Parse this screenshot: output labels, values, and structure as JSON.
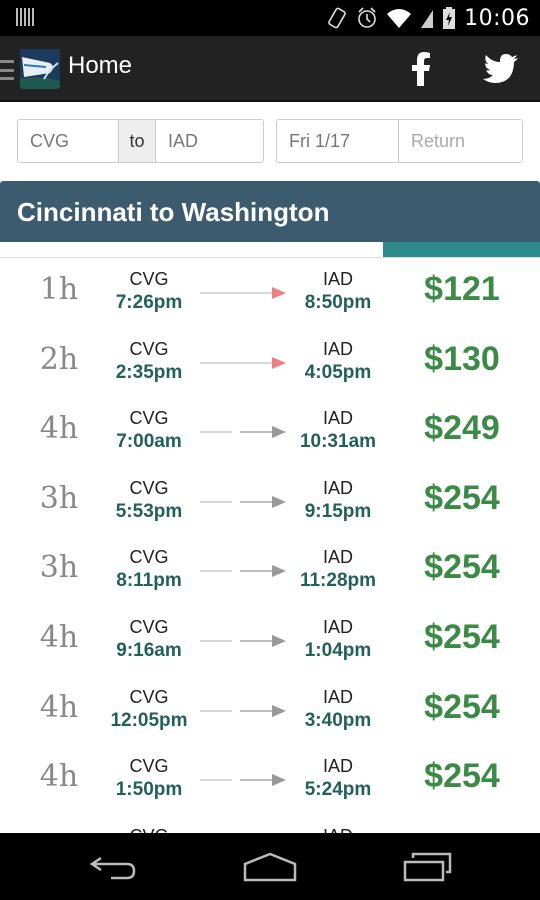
{
  "status_bar": {
    "time": "10:06",
    "icons": [
      "notification-icon",
      "vibrate-icon",
      "alarm-icon",
      "wifi-icon",
      "signal-icon",
      "battery-charging-icon"
    ]
  },
  "action_bar": {
    "title": "Home",
    "icons": [
      "menu-icon",
      "app-logo",
      "facebook-icon",
      "twitter-icon"
    ]
  },
  "search": {
    "origin": "CVG",
    "to_label": "to",
    "destination": "IAD",
    "depart_date": "Fri 1/17",
    "return_placeholder": "Return"
  },
  "route": {
    "title": "Cincinnati to Washington",
    "progress_percent": 71
  },
  "colors": {
    "header_bg": "#3d5b6e",
    "progress_fill": "#2e8b8b",
    "time_text": "#22605a",
    "price_text": "#3b8a45",
    "nonstop_arrow": "#f08080",
    "stop_arrow": "#999999"
  },
  "flights": [
    {
      "duration": "1h",
      "from": "CVG",
      "depart": "7:26pm",
      "to": "IAD",
      "arrive": "8:50pm",
      "price": "$121",
      "nonstop": true
    },
    {
      "duration": "2h",
      "from": "CVG",
      "depart": "2:35pm",
      "to": "IAD",
      "arrive": "4:05pm",
      "price": "$130",
      "nonstop": true
    },
    {
      "duration": "4h",
      "from": "CVG",
      "depart": "7:00am",
      "to": "IAD",
      "arrive": "10:31am",
      "price": "$249",
      "nonstop": false
    },
    {
      "duration": "3h",
      "from": "CVG",
      "depart": "5:53pm",
      "to": "IAD",
      "arrive": "9:15pm",
      "price": "$254",
      "nonstop": false
    },
    {
      "duration": "3h",
      "from": "CVG",
      "depart": "8:11pm",
      "to": "IAD",
      "arrive": "11:28pm",
      "price": "$254",
      "nonstop": false
    },
    {
      "duration": "4h",
      "from": "CVG",
      "depart": "9:16am",
      "to": "IAD",
      "arrive": "1:04pm",
      "price": "$254",
      "nonstop": false
    },
    {
      "duration": "4h",
      "from": "CVG",
      "depart": "12:05pm",
      "to": "IAD",
      "arrive": "3:40pm",
      "price": "$254",
      "nonstop": false
    },
    {
      "duration": "4h",
      "from": "CVG",
      "depart": "1:50pm",
      "to": "IAD",
      "arrive": "5:24pm",
      "price": "$254",
      "nonstop": false
    },
    {
      "duration": "",
      "from": "CVG",
      "depart": "",
      "to": "IAD",
      "arrive": "",
      "price": "",
      "nonstop": false
    }
  ],
  "nav_bar": {
    "buttons": [
      "back-icon",
      "home-icon",
      "recent-apps-icon"
    ]
  }
}
